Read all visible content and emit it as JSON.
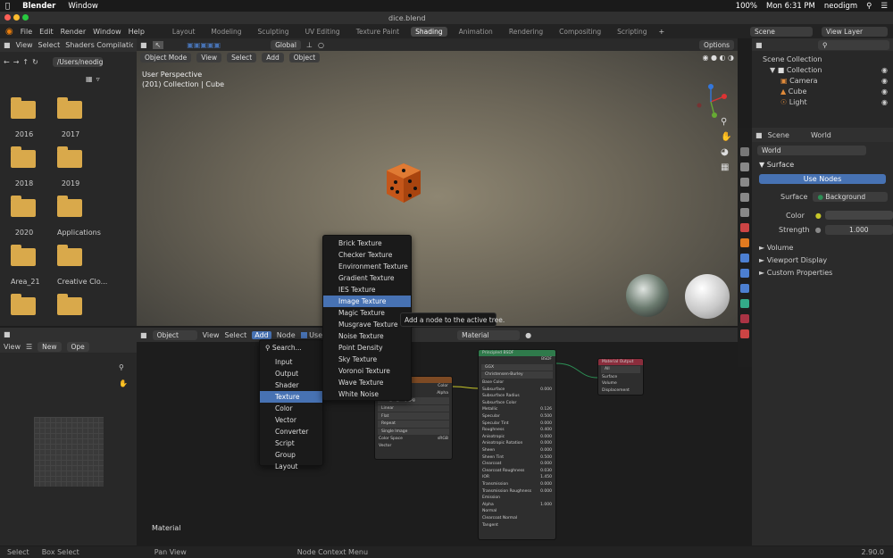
{
  "mac": {
    "app": "Blender",
    "window": "Window",
    "battery": "100%",
    "time": "Mon 6:31 PM",
    "user": "neodigm"
  },
  "file": "dice.blend",
  "blmenu": [
    "File",
    "Edit",
    "Render",
    "Window",
    "Help"
  ],
  "workspaces": [
    "Layout",
    "Modeling",
    "Sculpting",
    "UV Editing",
    "Texture Paint",
    "Shading",
    "Animation",
    "Rendering",
    "Compositing",
    "Scripting"
  ],
  "active_workspace": "Shading",
  "scene": "Scene",
  "view_layer": "View Layer",
  "fb": {
    "menu": [
      "View",
      "Select"
    ],
    "editor": "Shaders Compilatic",
    "path": "/Users/neodig...",
    "folders": [
      "2016",
      "2017",
      "2018",
      "2019",
      "2020",
      "Applications",
      "Area_21",
      "Creative Clo..."
    ]
  },
  "viewport": {
    "mode": "Object Mode",
    "menu": [
      "View",
      "Select",
      "Add",
      "Object"
    ],
    "transform": "Global",
    "options": "Options",
    "persp": "User Perspective",
    "coll": "(201) Collection | Cube"
  },
  "outliner": {
    "scene_coll": "Scene Collection",
    "collection": "Collection",
    "items": [
      "Camera",
      "Cube",
      "Light"
    ]
  },
  "props": {
    "scene_tab": "Scene",
    "world_tab": "World",
    "world": "World",
    "surface": "Surface",
    "use_nodes": "Use Nodes",
    "surface_lbl": "Surface",
    "background": "Background",
    "color_lbl": "Color",
    "strength_lbl": "Strength",
    "strength": "1.000",
    "volume": "Volume",
    "viewport_display": "Viewport Display",
    "custom_props": "Custom Properties"
  },
  "ne": {
    "object": "Object",
    "menu": [
      "View",
      "Select",
      "Add",
      "Node"
    ],
    "use": "Use",
    "material": "Material",
    "label": "Material"
  },
  "imgv": {
    "view": "View",
    "new": "New",
    "open": "Ope"
  },
  "addmenu": {
    "search": "Search...",
    "items": [
      "Input",
      "Output",
      "Shader",
      "Texture",
      "Color",
      "Vector",
      "Converter",
      "Script",
      "Group",
      "Layout"
    ],
    "selected": "Texture"
  },
  "texmenu": {
    "items": [
      "Brick Texture",
      "Checker Texture",
      "Environment Texture",
      "Gradient Texture",
      "IES Texture",
      "Image Texture",
      "Magic Texture",
      "Musgrave Texture",
      "Noise Texture",
      "Point Density",
      "Sky Texture",
      "Voronoi Texture",
      "Wave Texture",
      "White Noise"
    ],
    "selected": "Image Texture",
    "tooltip": "Add a node to the active tree."
  },
  "principled": {
    "title": "Principled BSDF",
    "out": "BSDF",
    "dist": "GGX",
    "sss": "Christensen-Burley",
    "rows": [
      [
        "Base Color",
        ""
      ],
      [
        "Subsurface",
        "0.000"
      ],
      [
        "Subsurface Radius",
        ""
      ],
      [
        "Subsurface Color",
        ""
      ],
      [
        "Metallic",
        "0.126"
      ],
      [
        "Specular",
        "0.500"
      ],
      [
        "Specular Tint",
        "0.000"
      ],
      [
        "Roughness",
        "0.400"
      ],
      [
        "Anisotropic",
        "0.000"
      ],
      [
        "Anisotropic Rotation",
        "0.000"
      ],
      [
        "Sheen",
        "0.000"
      ],
      [
        "Sheen Tint",
        "0.500"
      ],
      [
        "Clearcoat",
        "0.000"
      ],
      [
        "Clearcoat Roughness",
        "0.030"
      ],
      [
        "IOR",
        "1.450"
      ],
      [
        "Transmission",
        "0.000"
      ],
      [
        "Transmission Roughness",
        "0.000"
      ],
      [
        "Emission",
        ""
      ],
      [
        "Alpha",
        "1.000"
      ],
      [
        "Normal",
        ""
      ],
      [
        "Clearcoat Normal",
        ""
      ],
      [
        "Tangent",
        ""
      ]
    ]
  },
  "imgnode": {
    "out": [
      "Color",
      "Alpha"
    ],
    "file": "dice_uv_map.jpg",
    "opts": [
      "Linear",
      "Flat",
      "Repeat",
      "Single Image"
    ],
    "cs_lbl": "Color Space",
    "cs": "sRGB",
    "vector": "Vector"
  },
  "matout": {
    "title": "Material Output",
    "target": "All",
    "ins": [
      "Surface",
      "Volume",
      "Displacement"
    ]
  },
  "status": {
    "select": "Select",
    "box": "Box Select",
    "pan": "Pan View",
    "ctx": "Node Context Menu",
    "ver": "2.90.0"
  },
  "colors": {
    "accent": "#4772b3",
    "dice": "#d66a1f",
    "folder": "#d9a94b"
  }
}
